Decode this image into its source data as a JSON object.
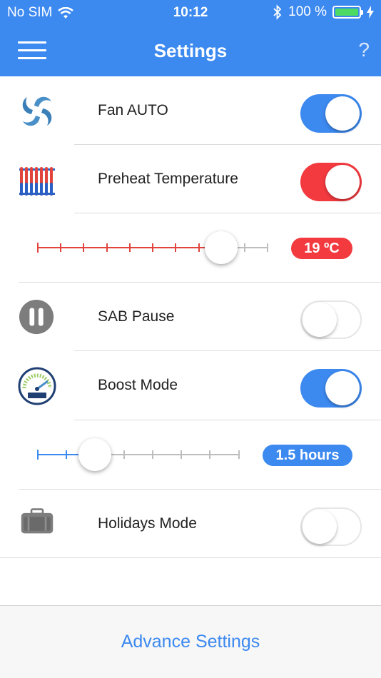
{
  "status_bar": {
    "carrier": "No SIM",
    "time": "10:12",
    "battery": "100 %"
  },
  "nav": {
    "title": "Settings",
    "help": "?"
  },
  "settings": {
    "fan_auto": {
      "label": "Fan AUTO",
      "enabled": true
    },
    "preheat": {
      "label": "Preheat Temperature",
      "enabled": true,
      "value_label": "19 ºC"
    },
    "sab_pause": {
      "label": "SAB Pause",
      "enabled": false
    },
    "boost_mode": {
      "label": "Boost Mode",
      "enabled": true,
      "value_label": "1.5 hours"
    },
    "holidays_mode": {
      "label": "Holidays Mode",
      "enabled": false
    }
  },
  "footer": {
    "advance_settings": "Advance Settings"
  },
  "colors": {
    "primary_blue": "#3c89f0",
    "alert_red": "#f23a3f",
    "battery_green": "#4cd964"
  }
}
